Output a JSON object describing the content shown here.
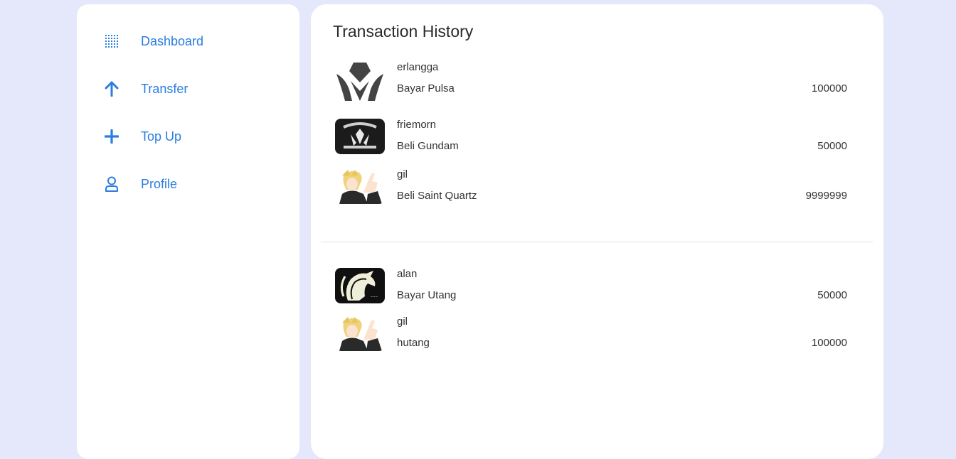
{
  "sidebar": {
    "items": [
      {
        "label": "Dashboard",
        "icon": "grid-icon"
      },
      {
        "label": "Transfer",
        "icon": "arrow-up-icon"
      },
      {
        "label": "Top Up",
        "icon": "plus-icon"
      },
      {
        "label": "Profile",
        "icon": "user-icon"
      }
    ]
  },
  "main": {
    "title": "Transaction History",
    "groups": [
      {
        "transactions": [
          {
            "name": "erlangga",
            "description": "Bayar Pulsa",
            "amount": "100000",
            "avatar": "crest-avatar"
          },
          {
            "name": "friemorn",
            "description": "Beli Gundam",
            "amount": "50000",
            "avatar": "iron-blooded-avatar"
          },
          {
            "name": "gil",
            "description": "Beli Saint Quartz",
            "amount": "9999999",
            "avatar": "anime-avatar"
          }
        ]
      },
      {
        "transactions": [
          {
            "name": "alan",
            "description": "Bayar Utang",
            "amount": "50000",
            "avatar": "unicorn-avatar"
          },
          {
            "name": "gil",
            "description": "hutang",
            "amount": "100000",
            "avatar": "anime-avatar"
          }
        ]
      }
    ]
  },
  "colors": {
    "background": "#e5e8fa",
    "accent": "#2a7de1",
    "text": "#333333"
  }
}
